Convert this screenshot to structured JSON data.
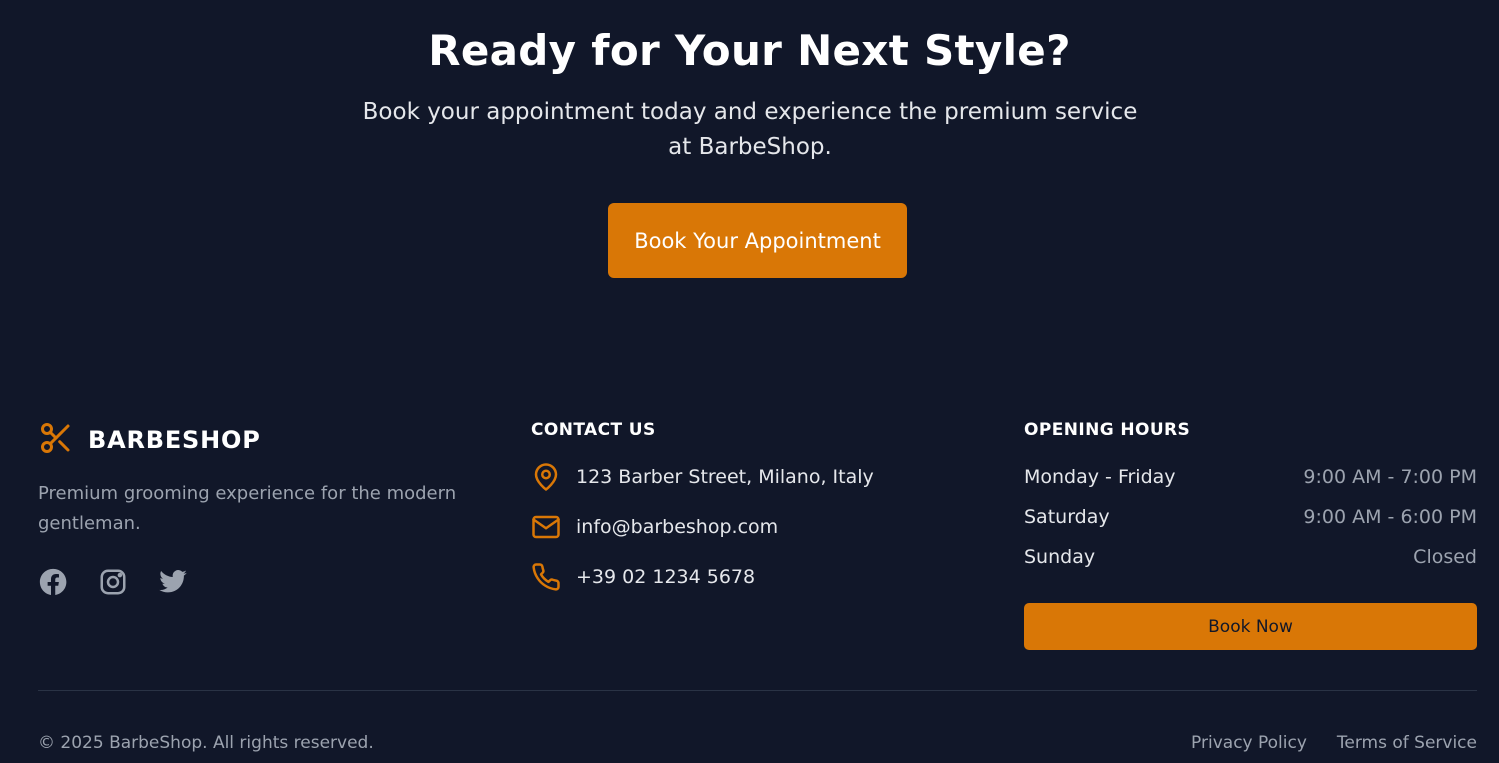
{
  "colors": {
    "background": "#111729",
    "accent": "#d97706",
    "muted_text": "#9ca3af",
    "light_text": "#e5e7eb"
  },
  "cta": {
    "title": "Ready for Your Next Style?",
    "subtitle": "Book your appointment today and experience the premium service at BarbeShop.",
    "button_label": "Book Your Appointment"
  },
  "brand": {
    "icon": "scissors-icon",
    "name": "BARBESHOP",
    "description": "Premium grooming experience for the modern gentleman.",
    "socials": [
      "facebook-icon",
      "instagram-icon",
      "twitter-icon"
    ]
  },
  "contact": {
    "heading": "CONTACT US",
    "items": [
      {
        "icon": "map-pin-icon",
        "text": "123 Barber Street, Milano, Italy"
      },
      {
        "icon": "mail-icon",
        "text": "info@barbeshop.com"
      },
      {
        "icon": "phone-icon",
        "text": "+39 02 1234 5678"
      }
    ]
  },
  "hours": {
    "heading": "OPENING HOURS",
    "rows": [
      {
        "day": "Monday - Friday",
        "time": "9:00 AM - 7:00 PM"
      },
      {
        "day": "Saturday",
        "time": "9:00 AM - 6:00 PM"
      },
      {
        "day": "Sunday",
        "time": "Closed"
      }
    ],
    "button_label": "Book Now"
  },
  "footer": {
    "copyright": "© 2025 BarbeShop. All rights reserved.",
    "links": [
      "Privacy Policy",
      "Terms of Service"
    ]
  }
}
